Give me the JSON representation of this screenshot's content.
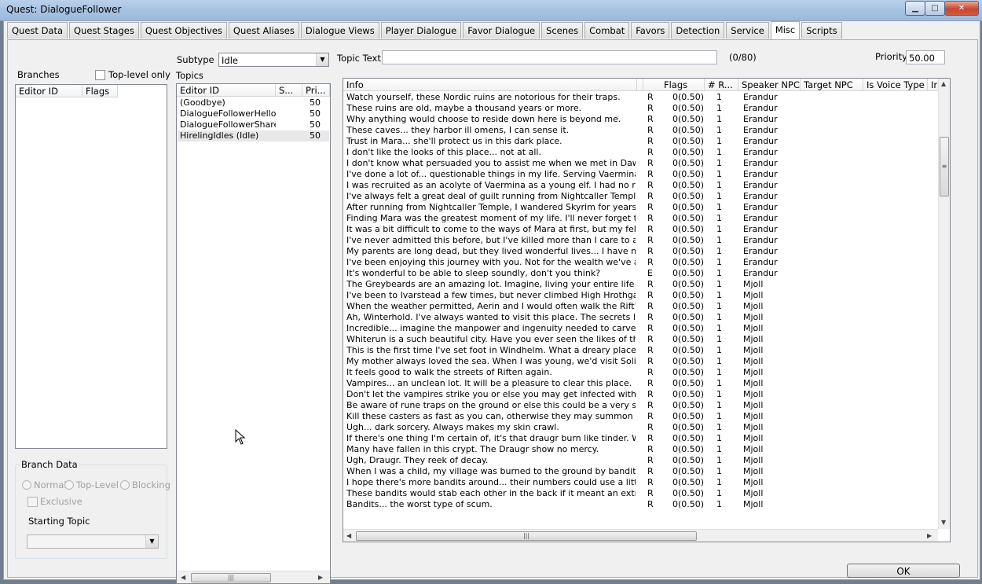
{
  "window": {
    "title": "Quest: DialogueFollower"
  },
  "tabs": [
    {
      "label": "Quest Data"
    },
    {
      "label": "Quest Stages"
    },
    {
      "label": "Quest Objectives"
    },
    {
      "label": "Quest Aliases"
    },
    {
      "label": "Dialogue Views"
    },
    {
      "label": "Player Dialogue"
    },
    {
      "label": "Favor Dialogue"
    },
    {
      "label": "Scenes"
    },
    {
      "label": "Combat"
    },
    {
      "label": "Favors"
    },
    {
      "label": "Detection"
    },
    {
      "label": "Service"
    },
    {
      "label": "Misc"
    },
    {
      "label": "Scripts"
    }
  ],
  "branches": {
    "label": "Branches",
    "toplevel_only_label": "Top-level only",
    "columns": [
      "Editor ID",
      "Flags"
    ]
  },
  "branch_data": {
    "title": "Branch Data",
    "radios": [
      "Normal",
      "Top-Level",
      "Blocking"
    ],
    "exclusive_label": "Exclusive",
    "starting_topic_label": "Starting Topic",
    "starting_topic_value": ""
  },
  "subtype": {
    "label": "Subtype",
    "value": "Idle"
  },
  "topics": {
    "label": "Topics",
    "columns": [
      "Editor ID",
      "S...",
      "Pri..."
    ],
    "rows": [
      {
        "id": "(Goodbye)",
        "s": "",
        "pri": "50"
      },
      {
        "id": "DialogueFollowerHellos...",
        "s": "",
        "pri": "50"
      },
      {
        "id": "DialogueFollowerShare...",
        "s": "",
        "pri": "50"
      },
      {
        "id": "HirelingIdles (Idle)",
        "s": "",
        "pri": "50"
      }
    ]
  },
  "topic_text": {
    "label": "Topic Text",
    "value": "",
    "counter": "(0/80)"
  },
  "priority": {
    "label": "Priority",
    "value": "50.00"
  },
  "info": {
    "columns": [
      "Info",
      "Flags",
      "# R...",
      "Speaker NPC",
      "Target NPC",
      "Is Voice Type",
      "Ir"
    ],
    "rows": [
      {
        "text": "Watch yourself, these Nordic ruins are notorious for their traps.",
        "flag": "R",
        "cond": "0(0.50)",
        "n": "1",
        "speaker": "Erandur"
      },
      {
        "text": "These ruins are old, maybe a thousand years or more.",
        "flag": "R",
        "cond": "0(0.50)",
        "n": "1",
        "speaker": "Erandur"
      },
      {
        "text": "Why anything would choose to reside down here is beyond me.",
        "flag": "R",
        "cond": "0(0.50)",
        "n": "1",
        "speaker": "Erandur"
      },
      {
        "text": "These caves... they harbor ill omens, I can sense it.",
        "flag": "R",
        "cond": "0(0.50)",
        "n": "1",
        "speaker": "Erandur"
      },
      {
        "text": "Trust in Mara... she'll protect us in this dark place.",
        "flag": "R",
        "cond": "0(0.50)",
        "n": "1",
        "speaker": "Erandur"
      },
      {
        "text": "I don't like the looks of this place... not at all.",
        "flag": "R",
        "cond": "0(0.50)",
        "n": "1",
        "speaker": "Erandur"
      },
      {
        "text": "I don't know what persuaded you to assist me when we met in Dawnstar, b...",
        "flag": "R",
        "cond": "0(0.50)",
        "n": "1",
        "speaker": "Erandur"
      },
      {
        "text": "I've done a lot of... questionable things in my life. Serving Vaermina was a h...",
        "flag": "R",
        "cond": "0(0.50)",
        "n": "1",
        "speaker": "Erandur"
      },
      {
        "text": "I was recruited as an acolyte of Vaermina as a young elf. I had no real child...",
        "flag": "R",
        "cond": "0(0.50)",
        "n": "1",
        "speaker": "Erandur"
      },
      {
        "text": "I've always felt a great deal of guilt running from Nightcaller Temple and lea...",
        "flag": "R",
        "cond": "0(0.50)",
        "n": "1",
        "speaker": "Erandur"
      },
      {
        "text": "After running from Nightcaller Temple, I wandered Skyrim for years until I wa...",
        "flag": "R",
        "cond": "0(0.50)",
        "n": "1",
        "speaker": "Erandur"
      },
      {
        "text": "Finding Mara was the greatest moment of my life. I'll never forget the warmt...",
        "flag": "R",
        "cond": "0(0.50)",
        "n": "1",
        "speaker": "Erandur"
      },
      {
        "text": "It was a bit difficult to come to the ways of Mara at first, but my fellow priests...",
        "flag": "R",
        "cond": "0(0.50)",
        "n": "1",
        "speaker": "Erandur"
      },
      {
        "text": "I've never admitted this before, but I've killed more than I care to admit. I'll j...",
        "flag": "R",
        "cond": "0(0.50)",
        "n": "1",
        "speaker": "Erandur"
      },
      {
        "text": "My parents are long dead, but they lived wonderful lives... I have no sad st...",
        "flag": "R",
        "cond": "0(0.50)",
        "n": "1",
        "speaker": "Erandur"
      },
      {
        "text": "I've been enjoying this journey with you. Not for the wealth we've accumula...",
        "flag": "R",
        "cond": "0(0.50)",
        "n": "1",
        "speaker": "Erandur"
      },
      {
        "text": "It's wonderful to be able to sleep soundly, don't you think?",
        "flag": "E",
        "cond": "0(0.50)",
        "n": "1",
        "speaker": "Erandur"
      },
      {
        "text": "The Greybeards are an amazing lot. Imagine, living your entire life without s...",
        "flag": "R",
        "cond": "0(0.50)",
        "n": "1",
        "speaker": "Mjoll"
      },
      {
        "text": "I've been to Ivarstead a few times, but never climbed High Hrothgar. I woul...",
        "flag": "R",
        "cond": "0(0.50)",
        "n": "1",
        "speaker": "Mjoll"
      },
      {
        "text": "When the weather permitted, Aerin and I would often walk the Rift's forests....",
        "flag": "R",
        "cond": "0(0.50)",
        "n": "1",
        "speaker": "Mjoll"
      },
      {
        "text": "Ah, Winterhold. I've always wanted to visit this place. The secrets locked in...",
        "flag": "R",
        "cond": "0(0.50)",
        "n": "1",
        "speaker": "Mjoll"
      },
      {
        "text": "Incredible... imagine the manpower and ingenuity needed to carve the build...",
        "flag": "R",
        "cond": "0(0.50)",
        "n": "1",
        "speaker": "Mjoll"
      },
      {
        "text": "Whiterun is a such beautiful city. Have you ever seen the likes of this place?",
        "flag": "R",
        "cond": "0(0.50)",
        "n": "1",
        "speaker": "Mjoll"
      },
      {
        "text": "This is the first time I've set foot in Windhelm. What a dreary place.",
        "flag": "R",
        "cond": "0(0.50)",
        "n": "1",
        "speaker": "Mjoll"
      },
      {
        "text": "My mother always loved the sea. When I was young, we'd visit Solitude an...",
        "flag": "R",
        "cond": "0(0.50)",
        "n": "1",
        "speaker": "Mjoll"
      },
      {
        "text": "It feels good to walk the streets of Riften again.",
        "flag": "R",
        "cond": "0(0.50)",
        "n": "1",
        "speaker": "Mjoll"
      },
      {
        "text": "Vampires... an unclean lot. It will be a pleasure to clear this place.",
        "flag": "R",
        "cond": "0(0.50)",
        "n": "1",
        "speaker": "Mjoll"
      },
      {
        "text": "Don't let the vampires strike you or else you may get infected with their bloo...",
        "flag": "R",
        "cond": "0(0.50)",
        "n": "1",
        "speaker": "Mjoll"
      },
      {
        "text": "Be aware of rune traps on the ground or else this could be a very short exp...",
        "flag": "R",
        "cond": "0(0.50)",
        "n": "1",
        "speaker": "Mjoll"
      },
      {
        "text": "Kill these casters as fast as you can, otherwise they may summon creatures...",
        "flag": "R",
        "cond": "0(0.50)",
        "n": "1",
        "speaker": "Mjoll"
      },
      {
        "text": "Ugh... dark sorcery. Always makes my skin crawl.",
        "flag": "R",
        "cond": "0(0.50)",
        "n": "1",
        "speaker": "Mjoll"
      },
      {
        "text": "If there's one thing I'm certain of, it's that draugr burn like tinder. We could u...",
        "flag": "R",
        "cond": "0(0.50)",
        "n": "1",
        "speaker": "Mjoll"
      },
      {
        "text": "Many have fallen in this crypt. The Draugr show no mercy.",
        "flag": "R",
        "cond": "0(0.50)",
        "n": "1",
        "speaker": "Mjoll"
      },
      {
        "text": "Ugh, Draugr. They reek of decay.",
        "flag": "R",
        "cond": "0(0.50)",
        "n": "1",
        "speaker": "Mjoll"
      },
      {
        "text": "When I was a child, my village was burned to the ground by bandits. Do yo...",
        "flag": "R",
        "cond": "0(0.50)",
        "n": "1",
        "speaker": "Mjoll"
      },
      {
        "text": "I hope there's more bandits around... their numbers could use a little more th...",
        "flag": "R",
        "cond": "0(0.50)",
        "n": "1",
        "speaker": "Mjoll"
      },
      {
        "text": "These bandits would stab each other in the back if it meant an extra coin in...",
        "flag": "R",
        "cond": "0(0.50)",
        "n": "1",
        "speaker": "Mjoll"
      },
      {
        "text": "Bandits... the worst type of scum.",
        "flag": "R",
        "cond": "0(0.50)",
        "n": "1",
        "speaker": "Mjoll"
      }
    ]
  },
  "ok_button": {
    "label": "OK"
  },
  "icons": {
    "minimize": "minimize-icon",
    "maximize": "maximize-icon",
    "close": "close-icon",
    "dropdown": "chevron-down-icon",
    "cursor": "mouse-cursor-icon"
  }
}
